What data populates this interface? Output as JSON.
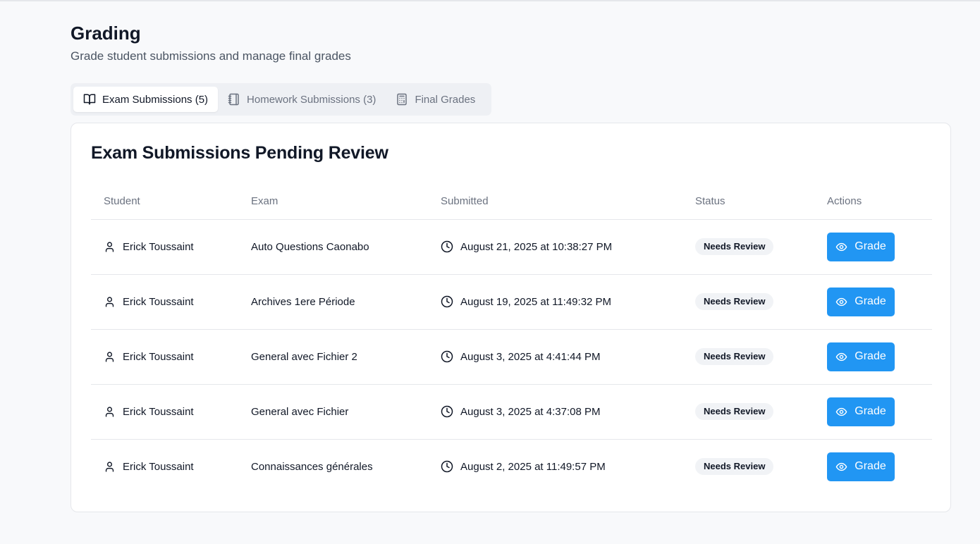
{
  "page": {
    "title": "Grading",
    "subtitle": "Grade student submissions and manage final grades"
  },
  "tabs": [
    {
      "label": "Exam Submissions (5)",
      "icon": "book-open-icon",
      "active": true
    },
    {
      "label": "Homework Submissions (3)",
      "icon": "notebook-icon",
      "active": false
    },
    {
      "label": "Final Grades",
      "icon": "calculator-icon",
      "active": false
    }
  ],
  "card": {
    "title": "Exam Submissions Pending Review"
  },
  "table": {
    "headers": {
      "student": "Student",
      "exam": "Exam",
      "submitted": "Submitted",
      "status": "Status",
      "actions": "Actions"
    },
    "rows": [
      {
        "student": "Erick Toussaint",
        "exam": "Auto Questions Caonabo",
        "submitted": "August 21, 2025 at 10:38:27 PM",
        "status": "Needs Review",
        "action": "Grade"
      },
      {
        "student": "Erick Toussaint",
        "exam": "Archives 1ere Période",
        "submitted": "August 19, 2025 at 11:49:32 PM",
        "status": "Needs Review",
        "action": "Grade"
      },
      {
        "student": "Erick Toussaint",
        "exam": "General avec Fichier 2",
        "submitted": "August 3, 2025 at 4:41:44 PM",
        "status": "Needs Review",
        "action": "Grade"
      },
      {
        "student": "Erick Toussaint",
        "exam": "General avec Fichier",
        "submitted": "August 3, 2025 at 4:37:08 PM",
        "status": "Needs Review",
        "action": "Grade"
      },
      {
        "student": "Erick Toussaint",
        "exam": "Connaissances générales",
        "submitted": "August 2, 2025 at 11:49:57 PM",
        "status": "Needs Review",
        "action": "Grade"
      }
    ]
  },
  "colors": {
    "accent": "#2196f3",
    "background": "#f8f9fb",
    "badge_bg": "#f1f3f6"
  }
}
